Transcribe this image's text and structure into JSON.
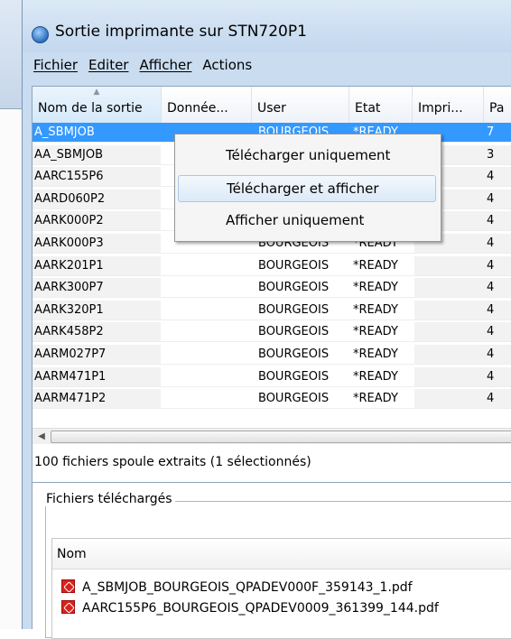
{
  "window": {
    "title": "Sortie imprimante sur STN720P1"
  },
  "menubar": {
    "items": [
      "Fichier",
      "Editer",
      "Afficher",
      "Actions"
    ]
  },
  "list": {
    "columns": [
      "Nom de la sortie",
      "Donnée...",
      "User",
      "Etat",
      "Impri...",
      "Pa"
    ],
    "rows": [
      {
        "name": "A_SBMJOB",
        "user": "BOURGEOIS",
        "state": "*READY",
        "pages": "7",
        "selected": true
      },
      {
        "name": "AA_SBMJOB",
        "user": "",
        "state": "",
        "pages": "3"
      },
      {
        "name": "AARC155P6",
        "user": "",
        "state": "",
        "pages": "4"
      },
      {
        "name": "AARD060P2",
        "user": "",
        "state": "",
        "pages": "4"
      },
      {
        "name": "AARK000P2",
        "user": "",
        "state": "",
        "pages": "4"
      },
      {
        "name": "AARK000P3",
        "user": "BOURGEOIS",
        "state": "*READY",
        "pages": "4"
      },
      {
        "name": "AARK201P1",
        "user": "BOURGEOIS",
        "state": "*READY",
        "pages": "4"
      },
      {
        "name": "AARK300P7",
        "user": "BOURGEOIS",
        "state": "*READY",
        "pages": "4"
      },
      {
        "name": "AARK320P1",
        "user": "BOURGEOIS",
        "state": "*READY",
        "pages": "4"
      },
      {
        "name": "AARK458P2",
        "user": "BOURGEOIS",
        "state": "*READY",
        "pages": "4"
      },
      {
        "name": "AARM027P7",
        "user": "BOURGEOIS",
        "state": "*READY",
        "pages": "4"
      },
      {
        "name": "AARM471P1",
        "user": "BOURGEOIS",
        "state": "*READY",
        "pages": "4"
      },
      {
        "name": "AARM471P2",
        "user": "BOURGEOIS",
        "state": "*READY",
        "pages": "4"
      }
    ]
  },
  "context_menu": {
    "items": [
      "Télécharger uniquement",
      "Télécharger et afficher",
      "Afficher uniquement"
    ],
    "highlighted_index": 1
  },
  "status": {
    "text": "100 fichiers spoule extraits (1 sélectionnés)"
  },
  "downloads": {
    "group_title": "Fichiers téléchargés",
    "column_header": "Nom",
    "files": [
      "A_SBMJOB_BOURGEOIS_QPADEV000F_359143_1.pdf",
      "AARC155P6_BOURGEOIS_QPADEV0009_361399_144.pdf"
    ],
    "file_icon": "pdf-icon"
  },
  "colors": {
    "selection": "#3399ff",
    "title_bar": "#c3d7ee",
    "pdf_icon": "#d9221b"
  }
}
